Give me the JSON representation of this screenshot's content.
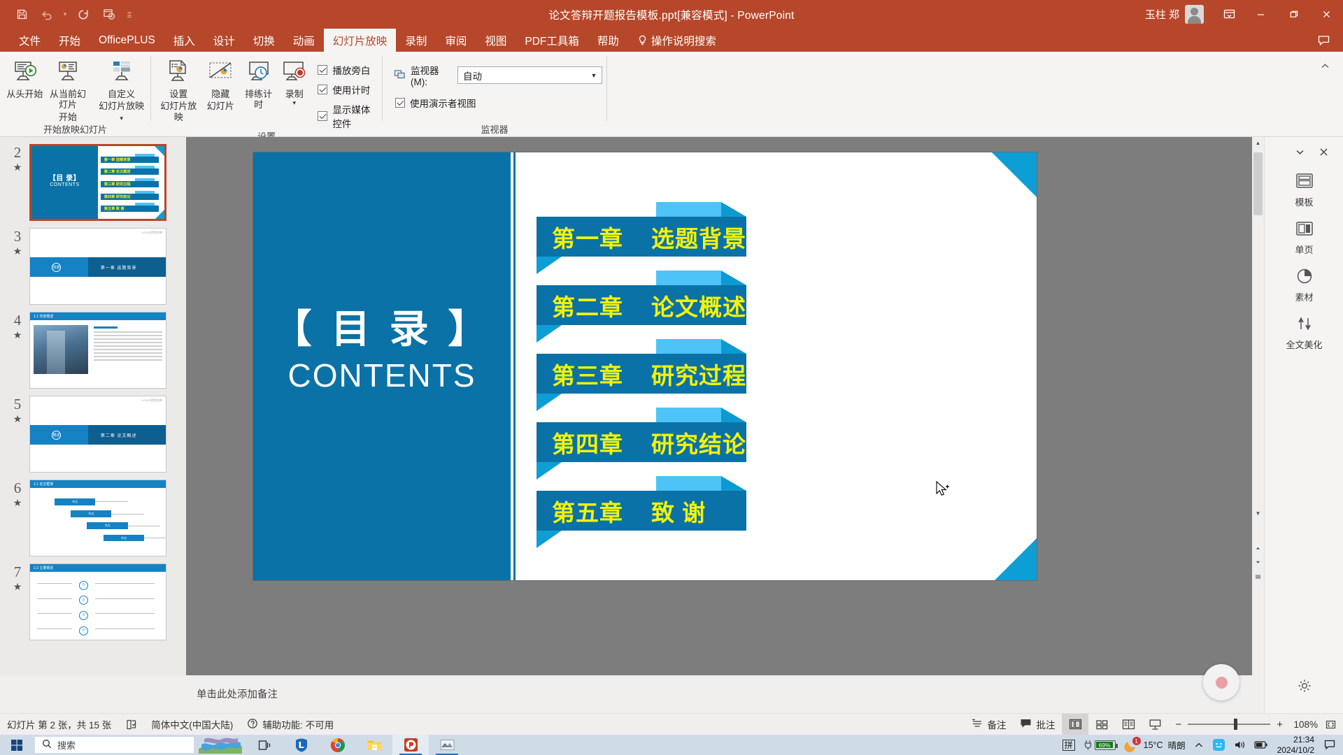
{
  "titlebar": {
    "doc_title": "论文答辩开题报告模板.ppt[兼容模式]  -  PowerPoint",
    "user_name": "玉柱 郑",
    "qat": [
      {
        "name": "save",
        "glyph": "save-icon"
      },
      {
        "name": "undo",
        "glyph": "undo-icon"
      },
      {
        "name": "undo-dropdown",
        "glyph": "chevron-down-icon"
      },
      {
        "name": "redo",
        "glyph": "redo-icon"
      },
      {
        "name": "start-from-beginning",
        "glyph": "present-icon"
      },
      {
        "name": "customize-qat",
        "glyph": "overflow-icon"
      }
    ],
    "window_buttons": {
      "minimize": "—",
      "restore": "❐",
      "close": "✕"
    },
    "ribbon_display_label": "ribbon-display-options"
  },
  "tabs": [
    {
      "label": "文件",
      "active": false
    },
    {
      "label": "开始",
      "active": false
    },
    {
      "label": "OfficePLUS",
      "active": false
    },
    {
      "label": "插入",
      "active": false
    },
    {
      "label": "设计",
      "active": false
    },
    {
      "label": "切换",
      "active": false
    },
    {
      "label": "动画",
      "active": false
    },
    {
      "label": "幻灯片放映",
      "active": true
    },
    {
      "label": "录制",
      "active": false
    },
    {
      "label": "审阅",
      "active": false
    },
    {
      "label": "视图",
      "active": false
    },
    {
      "label": "PDF工具箱",
      "active": false
    },
    {
      "label": "帮助",
      "active": false
    },
    {
      "label": "操作说明搜索",
      "active": false
    }
  ],
  "ribbon": {
    "groups": [
      {
        "label": "开始放映幻灯片",
        "buttons": [
          {
            "name": "from-beginning",
            "line1": "从头开始",
            "line2": "",
            "icon": "present-from-start-icon",
            "caret": false
          },
          {
            "name": "from-current-slide",
            "line1": "从当前幻灯片",
            "line2": "开始",
            "icon": "present-from-current-icon",
            "caret": false
          },
          {
            "name": "custom-slide-show",
            "line1": "自定义",
            "line2": "幻灯片放映",
            "icon": "custom-show-icon",
            "caret": true
          }
        ]
      },
      {
        "label": "设置",
        "buttons": [
          {
            "name": "set-up-slide-show",
            "line1": "设置",
            "line2": "幻灯片放映",
            "icon": "setup-show-icon",
            "caret": false
          },
          {
            "name": "hide-slide",
            "line1": "隐藏",
            "line2": "幻灯片",
            "icon": "hide-slide-icon",
            "caret": false
          },
          {
            "name": "rehearse-timings",
            "line1": "排练计时",
            "line2": "",
            "icon": "rehearse-timings-icon",
            "caret": false
          },
          {
            "name": "record-slide-show",
            "line1": "录制",
            "line2": "",
            "icon": "record-icon",
            "caret": true
          }
        ],
        "checkboxes": [
          {
            "label": "播放旁白",
            "checked": true
          },
          {
            "label": "使用计时",
            "checked": true
          },
          {
            "label": "显示媒体控件",
            "checked": true
          }
        ]
      },
      {
        "label": "监视器",
        "monitor_label": "监视器(M):",
        "monitor_value": "自动",
        "presenter_view": {
          "label": "使用演示者视图",
          "checked": true
        }
      }
    ]
  },
  "thumbnails": [
    {
      "number": "2",
      "starred": true,
      "selected": true,
      "kind": "contents",
      "title_cn": "【目  录】",
      "title_en": "CONTENTS",
      "items": [
        "第一章  选题背景",
        "第二章  论文概述",
        "第三章  研究过程",
        "第四章  研究结论",
        "第五章  致    谢"
      ]
    },
    {
      "number": "3",
      "starred": true,
      "selected": false,
      "kind": "section",
      "logo": "LOGO学院名称",
      "badge": "背景",
      "chapter": "第一章   选题背景"
    },
    {
      "number": "4",
      "starred": true,
      "selected": false,
      "kind": "photo",
      "header": "1.1 背景概述"
    },
    {
      "number": "5",
      "starred": true,
      "selected": false,
      "kind": "section",
      "logo": "LOGO学院名称",
      "badge": "概述",
      "chapter": "第二章   论文概述"
    },
    {
      "number": "6",
      "starred": true,
      "selected": false,
      "kind": "diagram",
      "header": "2.1 论文框架"
    },
    {
      "number": "7",
      "starred": true,
      "selected": false,
      "kind": "list",
      "header": "2.2 主要概念"
    }
  ],
  "slide": {
    "title_cn": "【 目   录 】",
    "title_en": "CONTENTS",
    "chapters": [
      {
        "num": "第一章",
        "name": "选题背景"
      },
      {
        "num": "第二章",
        "name": "论文概述"
      },
      {
        "num": "第三章",
        "name": "研究过程"
      },
      {
        "num": "第四章",
        "name": "研究结论"
      },
      {
        "num": "第五章",
        "name": "致    谢"
      }
    ],
    "colors": {
      "panel": "#0a72a6",
      "accent": "#0e9ed6",
      "tab": "#4dc3f7",
      "text": "#f4f20a"
    }
  },
  "notes": {
    "placeholder": "单击此处添加备注"
  },
  "rightbar": {
    "items": [
      {
        "label": "模板",
        "icon": "template-icon"
      },
      {
        "label": "单页",
        "icon": "single-page-icon"
      },
      {
        "label": "素材",
        "icon": "material-icon"
      },
      {
        "label": "全文美化",
        "icon": "beautify-icon"
      }
    ],
    "collapse": "chevron-down-icon",
    "close": "close-icon",
    "settings": "gear-icon",
    "record": "record-bubble-icon"
  },
  "statusbar": {
    "slide_counter": "幻灯片 第 2 张，共 15 张",
    "language": "简体中文(中国大陆)",
    "accessibility": "辅助功能: 不可用",
    "notes_label": "备注",
    "comments_label": "批注",
    "zoom_level": "108%",
    "zoom_out": "−",
    "zoom_in": "+",
    "views": [
      {
        "name": "normal-view",
        "active": true
      },
      {
        "name": "slide-sorter-view",
        "active": false
      },
      {
        "name": "reading-view",
        "active": false
      },
      {
        "name": "slide-show-view",
        "active": false
      }
    ]
  },
  "taskbar": {
    "search_placeholder": "搜索",
    "ime": "拼",
    "battery": "69%",
    "weather_temp": "15°C",
    "weather_desc": "晴朗",
    "time": "21:34",
    "date": "2024/10/2",
    "apps": [
      {
        "name": "taskview-icon"
      },
      {
        "name": "browser-lenovo-icon"
      },
      {
        "name": "chrome-icon"
      },
      {
        "name": "file-explorer-icon"
      },
      {
        "name": "powerpoint-icon"
      },
      {
        "name": "screen-capture-icon"
      }
    ]
  }
}
